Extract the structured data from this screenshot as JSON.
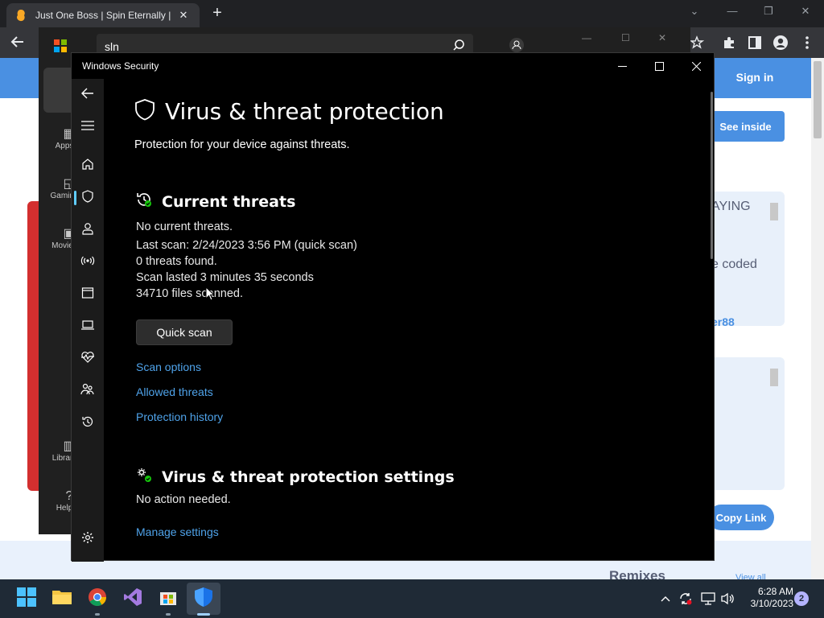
{
  "browser": {
    "tab_title": "Just One Boss | Spin Eternally | Cr",
    "page": {
      "sign_in": "Sign in",
      "see_inside": "See inside",
      "panel1_text1": "AYING",
      "panel1_text2": "e coded",
      "panel1_link": "er88",
      "copy_link": "Copy Link",
      "remixes": "Remixes",
      "view_all": "View all"
    }
  },
  "store": {
    "search_value": "sln",
    "nav": {
      "apps": "Apps",
      "gaming": "Gaming",
      "movies": "Movies",
      "library": "Library",
      "help": "Help"
    }
  },
  "security": {
    "window_title": "Windows Security",
    "page_title": "Virus & threat protection",
    "page_subtitle": "Protection for your device against threats.",
    "current_threats": {
      "heading": "Current threats",
      "status": "No current threats.",
      "last_scan": "Last scan: 2/24/2023 3:56 PM (quick scan)",
      "threats_found": "0 threats found.",
      "scan_duration": "Scan lasted 3 minutes 35 seconds",
      "files_scanned": "34710 files scanned.",
      "quick_scan_button": "Quick scan",
      "links": {
        "scan_options": "Scan options",
        "allowed_threats": "Allowed threats",
        "protection_history": "Protection history"
      }
    },
    "settings": {
      "heading": "Virus & threat protection settings",
      "status": "No action needed.",
      "manage_link": "Manage settings"
    },
    "accent_color": "#4fa3ea"
  },
  "taskbar": {
    "time": "6:28 AM",
    "date": "3/10/2023",
    "notification_count": "2"
  }
}
